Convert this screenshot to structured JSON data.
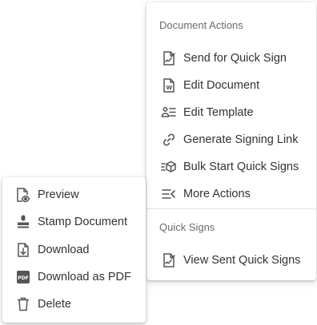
{
  "actions_menu": {
    "section1_title": "Document Actions",
    "items": [
      {
        "label": "Send for Quick Sign",
        "icon": "quick-sign-icon"
      },
      {
        "label": "Edit Document",
        "icon": "edit-document-icon"
      },
      {
        "label": "Edit Template",
        "icon": "edit-template-icon"
      },
      {
        "label": "Generate Signing Link",
        "icon": "link-icon"
      },
      {
        "label": "Bulk Start Quick Signs",
        "icon": "bulk-start-icon"
      },
      {
        "label": "More Actions",
        "icon": "more-actions-icon"
      }
    ],
    "section2_title": "Quick Signs",
    "items2": [
      {
        "label": "View Sent Quick Signs",
        "icon": "quick-sign-icon"
      }
    ]
  },
  "file_menu": {
    "items": [
      {
        "label": "Preview",
        "icon": "preview-icon"
      },
      {
        "label": "Stamp Document",
        "icon": "stamp-icon"
      },
      {
        "label": "Download",
        "icon": "download-icon"
      },
      {
        "label": "Download as PDF",
        "icon": "pdf-icon"
      },
      {
        "label": "Delete",
        "icon": "trash-icon"
      }
    ]
  },
  "colors": {
    "icon": "#555555",
    "text": "#333333",
    "section_title": "#6b6b6b"
  }
}
